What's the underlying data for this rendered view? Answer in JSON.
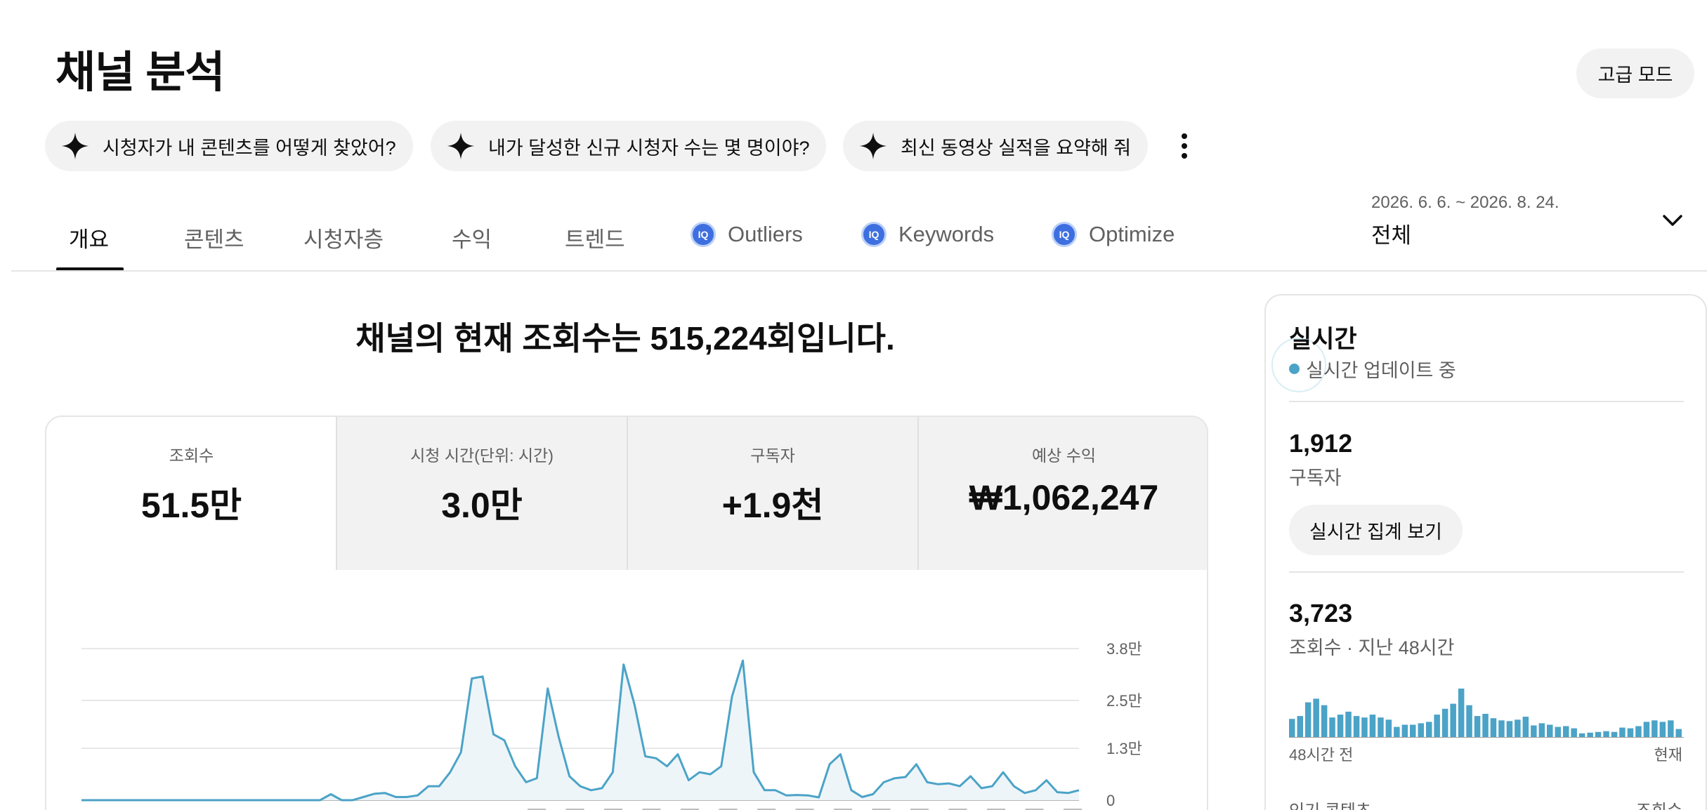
{
  "header": {
    "title": "채널 분석",
    "advanced_mode_label": "고급 모드"
  },
  "suggestions": [
    {
      "label": "시청자가 내 콘텐츠를 어떻게 찾았어?",
      "icon": "sparkle-icon"
    },
    {
      "label": "내가 달성한 신규 시청자 수는 몇 명이야?",
      "icon": "sparkle-icon"
    },
    {
      "label": "최신 동영상 실적을 요약해 줘",
      "icon": "sparkle-icon"
    }
  ],
  "tabs": [
    {
      "label": "개요",
      "active": true
    },
    {
      "label": "콘텐츠"
    },
    {
      "label": "시청자층"
    },
    {
      "label": "수익"
    },
    {
      "label": "트렌드"
    },
    {
      "label": "Outliers",
      "icon": "iq-icon"
    },
    {
      "label": "Keywords",
      "icon": "iq-icon"
    },
    {
      "label": "Optimize",
      "icon": "iq-icon"
    }
  ],
  "iq_badge": "IQ",
  "date_filter": {
    "range": "2026. 6. 6. ~ 2026. 8. 24.",
    "value": "전체"
  },
  "headline": "채널의 현재 조회수는 515,224회입니다.",
  "stats": [
    {
      "label": "조회수",
      "value": "51.5만",
      "active": true
    },
    {
      "label": "시청 시간(단위: 시간)",
      "value": "3.0만"
    },
    {
      "label": "구독자",
      "value": "+1.9천"
    },
    {
      "label": "예상 수익",
      "value": "₩1,062,247"
    }
  ],
  "chart_data": {
    "type": "area",
    "ylim": [
      0,
      38000
    ],
    "yticks": [
      {
        "value": 38000,
        "label": "3.8만"
      },
      {
        "value": 25000,
        "label": "2.5만"
      },
      {
        "value": 13000,
        "label": "1.3만"
      },
      {
        "value": 0,
        "label": "0"
      }
    ],
    "values": [
      0,
      0,
      0,
      0,
      0,
      0,
      0,
      0,
      0,
      0,
      0,
      0,
      0,
      0,
      0,
      0,
      0,
      0,
      0,
      0,
      0,
      0,
      0,
      1500,
      0,
      0,
      800,
      1600,
      1800,
      800,
      800,
      1200,
      3500,
      3500,
      7000,
      12000,
      30500,
      31000,
      16500,
      15000,
      8500,
      4500,
      5500,
      28000,
      16000,
      6000,
      3500,
      2500,
      3000,
      7000,
      34000,
      24000,
      11000,
      10500,
      8500,
      11500,
      5000,
      7000,
      6500,
      8500,
      26000,
      35000,
      7000,
      2500,
      2500,
      1200,
      1300,
      1200,
      700,
      9000,
      11500,
      2500,
      800,
      1500,
      4500,
      5500,
      5800,
      9000,
      4500,
      4000,
      4200,
      3500,
      6000,
      3000,
      3500,
      7000,
      3500,
      1800,
      2500,
      5000,
      2000,
      1800,
      2500
    ],
    "line_color": "#4ba3c7",
    "fill_color": "#eef5f9",
    "grid": true
  },
  "realtime": {
    "title": "실시간",
    "status": "실시간 업데이트 중",
    "subscribers_value": "1,912",
    "subscribers_label": "구독자",
    "aggregate_button": "실시간 집계 보기",
    "views_value": "3,723",
    "views_label": "조회수 · 지난 48시간",
    "bar_values": [
      26,
      30,
      49,
      54,
      45,
      28,
      32,
      36,
      30,
      28,
      32,
      28,
      25,
      15,
      18,
      18,
      20,
      22,
      32,
      40,
      47,
      68,
      45,
      30,
      33,
      27,
      24,
      23,
      25,
      29,
      17,
      20,
      18,
      15,
      16,
      13,
      6,
      7,
      8,
      9,
      8,
      14,
      13,
      16,
      22,
      24,
      22,
      24,
      12
    ],
    "bar_color": "#4ba3c7",
    "axis_start": "48시간 전",
    "axis_end": "현재",
    "popular_label": "인기 콘텐츠",
    "popular_metric": "조회수"
  }
}
